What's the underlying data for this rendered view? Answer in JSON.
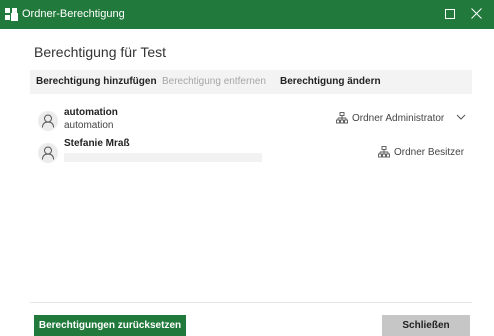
{
  "window": {
    "title": "Ordner-Berechtigung",
    "accent_color": "#217a3c",
    "controls": [
      "maximize-icon",
      "close-icon"
    ]
  },
  "heading": "Berechtigung für Test",
  "actions": {
    "add": "Berechtigung hinzufügen",
    "remove": "Berechtigung entfernen",
    "remove_state": "disabled",
    "change": "Berechtigung ändern"
  },
  "permissions": [
    {
      "name": "automation",
      "subtitle": "automation",
      "role": "Ordner Administrator",
      "role_icon": "org-chart-icon",
      "has_dropdown": true
    },
    {
      "name": "Stefanie Mraß",
      "subtitle": "",
      "role": "Ordner Besitzer",
      "role_icon": "org-chart-icon",
      "has_dropdown": false
    }
  ],
  "footer": {
    "reset_label": "Berechtigungen zurücksetzen",
    "close_label": "Schließen"
  }
}
